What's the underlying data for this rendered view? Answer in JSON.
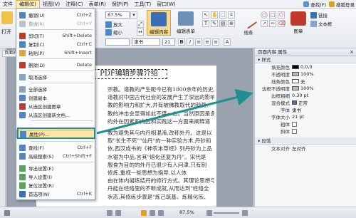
{
  "menubar": {
    "items": [
      "文件",
      "编辑(E)",
      "视图(V)",
      "注释(C)",
      "表单(R)",
      "保护(P)",
      "工具(T)",
      "窗口(W)"
    ],
    "active_index": 1,
    "right": [
      "查找(F)",
      "搜狐登录"
    ]
  },
  "ribbon": {
    "zoom": "87.5%",
    "font": "隶书",
    "font_size": "21",
    "left_label": "打开",
    "buttons": {
      "edit_content": "编辑内容",
      "edit_form": "编辑表单",
      "zoom_in": "放大",
      "zoom_out": "缩小",
      "text": "文本框",
      "shape": "线条",
      "image": "图章",
      "link": "链接"
    }
  },
  "doc_tab": "页面的",
  "edit_menu": {
    "items": [
      {
        "label": "撤销(U)",
        "shortcut": "Ctrl+Z",
        "disabled": false
      },
      {
        "label": "重做(R)",
        "shortcut": "Ctrl+Y",
        "disabled": true
      },
      {
        "label": "剪切(T)",
        "shortcut": "Shift+Delete",
        "disabled": false
      },
      {
        "label": "复制(C)",
        "shortcut": "Ctrl+C",
        "disabled": false
      },
      {
        "label": "粘贴(P)",
        "shortcut": "Shift+Insert",
        "disabled": false
      },
      {
        "label": "删除(D)",
        "shortcut": "Delete",
        "disabled": false
      },
      {
        "label": "取消选择",
        "shortcut": "",
        "disabled": false
      },
      {
        "label": "全部选择",
        "shortcut": "",
        "disabled": false
      },
      {
        "label": "创建副本",
        "shortcut": "",
        "disabled": false
      },
      {
        "label": "从选区创建图章",
        "shortcut": "",
        "disabled": false
      },
      {
        "label": "从选区创建新文档...",
        "shortcut": "",
        "disabled": false
      },
      {
        "label": "属性(P)...",
        "shortcut": "",
        "disabled": false
      },
      {
        "label": "查找(F)",
        "shortcut": "Ctrl+F",
        "disabled": false
      },
      {
        "label": "高级搜索(S)",
        "shortcut": "Ctrl+Shift+F",
        "disabled": false
      },
      {
        "label": "导出设置(E)",
        "shortcut": "",
        "disabled": false
      },
      {
        "label": "导入设置(I)",
        "shortcut": "",
        "disabled": false
      },
      {
        "label": "复位设置(R)",
        "shortcut": "",
        "disabled": false
      },
      {
        "label": "首选项(N)",
        "shortcut": "Ctrl+K",
        "disabled": false
      }
    ],
    "highlighted_index": 11
  },
  "document": {
    "title": "PDF编辑步骤介绍",
    "lines": [
      "宗教。道教的产生距今已有1800余年的历史。",
      "道教对中国古代社会的发展产生了深远的影响,",
      "教的影响力和扩大,并有被佛教取代的趋势,",
      "教的冲击会显得如此不堪一击。当然原因是多",
      "的外在因素和内因和实践这一方面来阐释道",
      "教为避免其与内丹相混淆,改称外丹。这是以",
      "取\"长生不死\"\"仙丹\"的一种实验方术,丹砂和",
      "依,西汉成书的《神农本草经》列丹砂为上品",
      "水银为中品,言其\"熔化还复为丹\"。宋代是",
      "服食为目的的外丹已很少有人问津,只有制",
      "修炼,重视一些思想为指导,以人体",
      "由在体内凝练结丹的修行方式。其理论思想与",
      "丹能在经络里的不断成就,从而达到\"经络全",
      "状态,其修练步骤是\"炼己筑基、炼精化炁、"
    ]
  },
  "props_panel": {
    "title": "页面内容 属性",
    "section_style": "样式",
    "rows": [
      {
        "label": "填充颜色",
        "value": "0,0,0",
        "kind": "color"
      },
      {
        "label": "不透明度",
        "value": "100%",
        "kind": "text"
      },
      {
        "label": "线条颜色",
        "value": "无",
        "kind": "color"
      },
      {
        "label": "边框不透明度",
        "value": "100%",
        "kind": "text"
      },
      {
        "label": "边框粗细",
        "value": "0.30 pt",
        "kind": "text"
      },
      {
        "label": "混合模式",
        "value": "正常",
        "kind": "text"
      },
      {
        "label": "字体",
        "value": "隶书",
        "kind": "text"
      },
      {
        "label": "字体大小",
        "value": "21 pt",
        "kind": "text"
      },
      {
        "label": "粗体",
        "value": "",
        "kind": "check"
      },
      {
        "label": "斜体",
        "value": "",
        "kind": "check"
      }
    ],
    "section_layout": "段落",
    "layout_rows": [
      {
        "label": "文本对齐",
        "value": "左对齐",
        "kind": "text"
      }
    ]
  },
  "status": {
    "zoom": "87.5%"
  },
  "colors": {
    "menu_highlight": "#fde7a6",
    "annotation_teal": "#1f8f93",
    "ribbon_pressed": "#f6d98a"
  }
}
